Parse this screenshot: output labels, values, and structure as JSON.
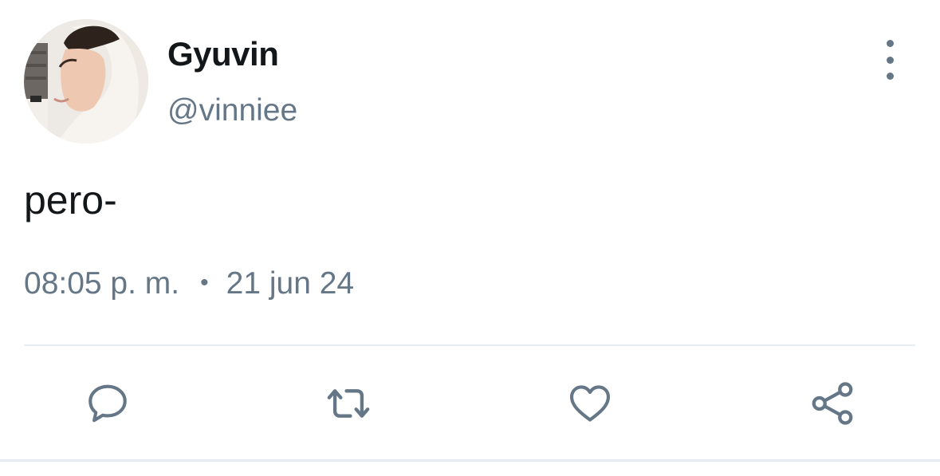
{
  "user": {
    "display_name": "Gyuvin",
    "handle": "@vinniee",
    "avatar_icon": "profile-photo"
  },
  "tweet": {
    "text": "pero-",
    "time": "08:05 p. m.",
    "separator": "•",
    "date": "21 jun 24"
  },
  "actions": [
    {
      "icon": "reply-icon"
    },
    {
      "icon": "retweet-icon"
    },
    {
      "icon": "like-icon"
    },
    {
      "icon": "share-icon"
    }
  ],
  "colors": {
    "primary_text": "#14171a",
    "secondary_text": "#657786",
    "divider": "#e6ecf0",
    "background": "#ffffff"
  }
}
